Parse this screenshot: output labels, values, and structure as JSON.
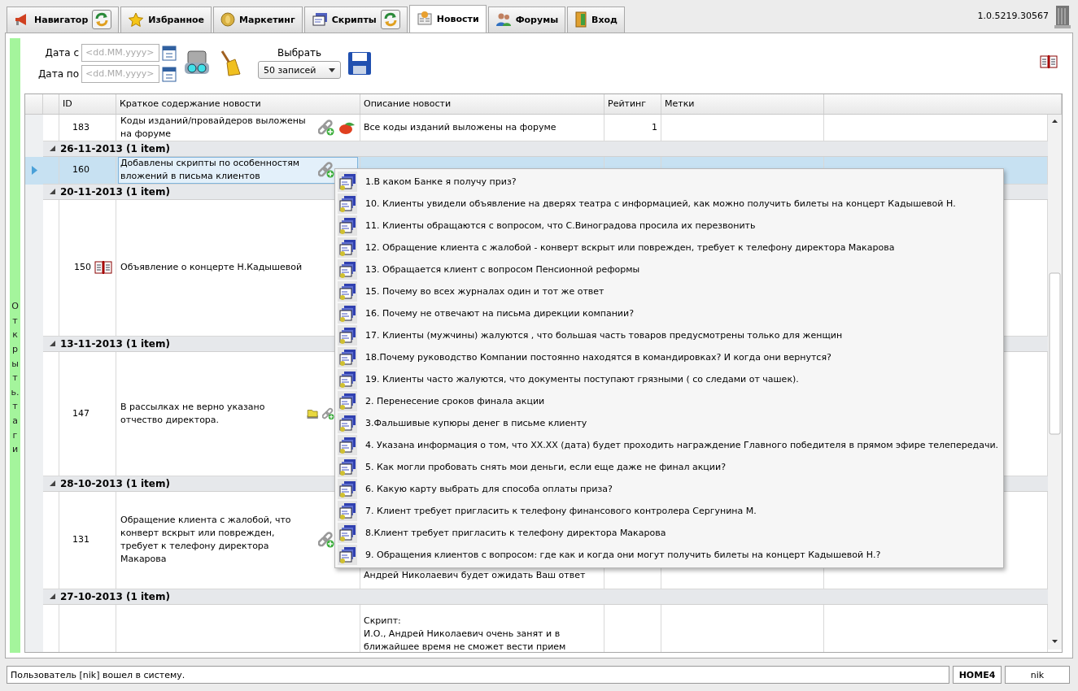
{
  "tabs": [
    {
      "label": "Навигатор",
      "selected": false,
      "refresh": true
    },
    {
      "label": "Избранное",
      "selected": false,
      "refresh": false
    },
    {
      "label": "Маркетинг",
      "selected": false,
      "refresh": false
    },
    {
      "label": "Скрипты",
      "selected": false,
      "refresh": true
    },
    {
      "label": "Новости",
      "selected": true,
      "refresh": false
    },
    {
      "label": "Форумы",
      "selected": false,
      "refresh": false
    },
    {
      "label": "Вход",
      "selected": false,
      "refresh": false
    }
  ],
  "version": "1.0.5219.30567",
  "side_panel": {
    "label": "Открыть.таги"
  },
  "filter": {
    "date_from_label": "Дата с",
    "date_from_placeholder": "<dd.MM.yyyy>",
    "date_to_label": "Дата по",
    "date_to_placeholder": "<dd.MM.yyyy>",
    "select_label": "Выбрать",
    "select_value": "50 записей"
  },
  "table": {
    "columns": [
      "ID",
      "Краткое содержание новости",
      "Описание новости",
      "Рейтинг",
      "Метки"
    ],
    "rows": [
      {
        "kind": "record",
        "selected": false,
        "id": "183",
        "book": false,
        "summary": "Коды изданий/провайдеров выложены на форуме",
        "folder": false,
        "link": true,
        "fruit": true,
        "description": [
          "Все коды изданий выложены на форуме"
        ],
        "rating": "1"
      },
      {
        "kind": "group",
        "label": "26-11-2013 (1 item)"
      },
      {
        "kind": "record",
        "selected": true,
        "id": "160",
        "book": false,
        "summary": "Добавлены скрипты по особенностям вложений в письма клиентов",
        "folder": false,
        "link": true,
        "fruit": false,
        "description": [],
        "rating": ""
      },
      {
        "kind": "group",
        "label": "20-11-2013 (1 item)"
      },
      {
        "kind": "record",
        "selected": false,
        "id": "150",
        "book": true,
        "summary": "Объявление о концерте Н.Кадышевой",
        "folder": false,
        "link": false,
        "fruit": false,
        "description": [],
        "rating": ""
      },
      {
        "kind": "group",
        "label": "13-11-2013 (1 item)"
      },
      {
        "kind": "record",
        "selected": false,
        "id": "147",
        "book": false,
        "summary": "В рассылках не верно указано отчество директора.",
        "folder": true,
        "link": true,
        "fruit": false,
        "description": [],
        "rating": ""
      },
      {
        "kind": "group",
        "label": "28-10-2013 (1 item)"
      },
      {
        "kind": "record",
        "selected": false,
        "id": "131",
        "book": false,
        "summary": "Обращение клиента с жалобой, что конверт вскрыт или поврежден, требует к телефону директора Макарова",
        "folder": false,
        "link": true,
        "fruit": false,
        "description": [
          "Андрей Николаевич будет ожидать Ваш ответ"
        ],
        "rating": ""
      },
      {
        "kind": "group",
        "label": "27-10-2013 (1 item)"
      },
      {
        "kind": "record",
        "selected": false,
        "id": "",
        "book": false,
        "summary": "",
        "folder": false,
        "link": false,
        "fruit": false,
        "description": [
          "Скрипт:",
          "И.О., Андрей Николаевич  очень занят и в",
          "ближайшее время не сможет вести прием"
        ],
        "rating": ""
      }
    ]
  },
  "menu": {
    "items": [
      "1.В каком Банке я получу приз?",
      "10. Клиенты увидели объявление на дверях театра с информацией, как можно получить билеты на концерт Кадышевой Н.",
      "11. Клиенты обращаются с вопросом, что  С.Виноградова  просила их перезвонить",
      "12. Обращение  клиента с жалобой - конверт вскрыт или поврежден, требует к телефону директора Макарова",
      "13. Обращается клиент с вопросом Пенсионной реформы",
      "15. Почему во всех журналах один и тот же ответ",
      "16. Почему не отвечают на письма дирекции компании?",
      "17.  Клиенты (мужчины) жалуются , что большая часть товаров предусмотрены только для женщин",
      "18.Почему руководство Компании постоянно находятся в командировках? И когда они вернутся?",
      "19. Клиенты часто жалуются, что документы поступают грязными ( со следами от чашек).",
      "2. Перенесение сроков финала акции",
      "3.Фальшивые купюры денег в письме клиенту",
      "4. Указана информация о том, что XX.XX (дата) будет проходить награждение Главного победителя в прямом эфире телепередачи.",
      "5. Как могли пробовать снять мои деньги, если еще даже не финал акции?",
      "6. Какую карту выбрать для способа оплаты приза?",
      "7. Клиент требует пригласить к телефону финансового контролера Сергунина М.",
      "8.Клиент требует пригласить к телефону директора Макарова",
      "9. Обращения клиентов с вопросом: где как и когда они могут получить билеты на концерт Кадышевой Н.?"
    ]
  },
  "status_bar": {
    "message": "Пользователь [nik] вошел в систему.",
    "server": "HOME4",
    "user": "nik"
  }
}
